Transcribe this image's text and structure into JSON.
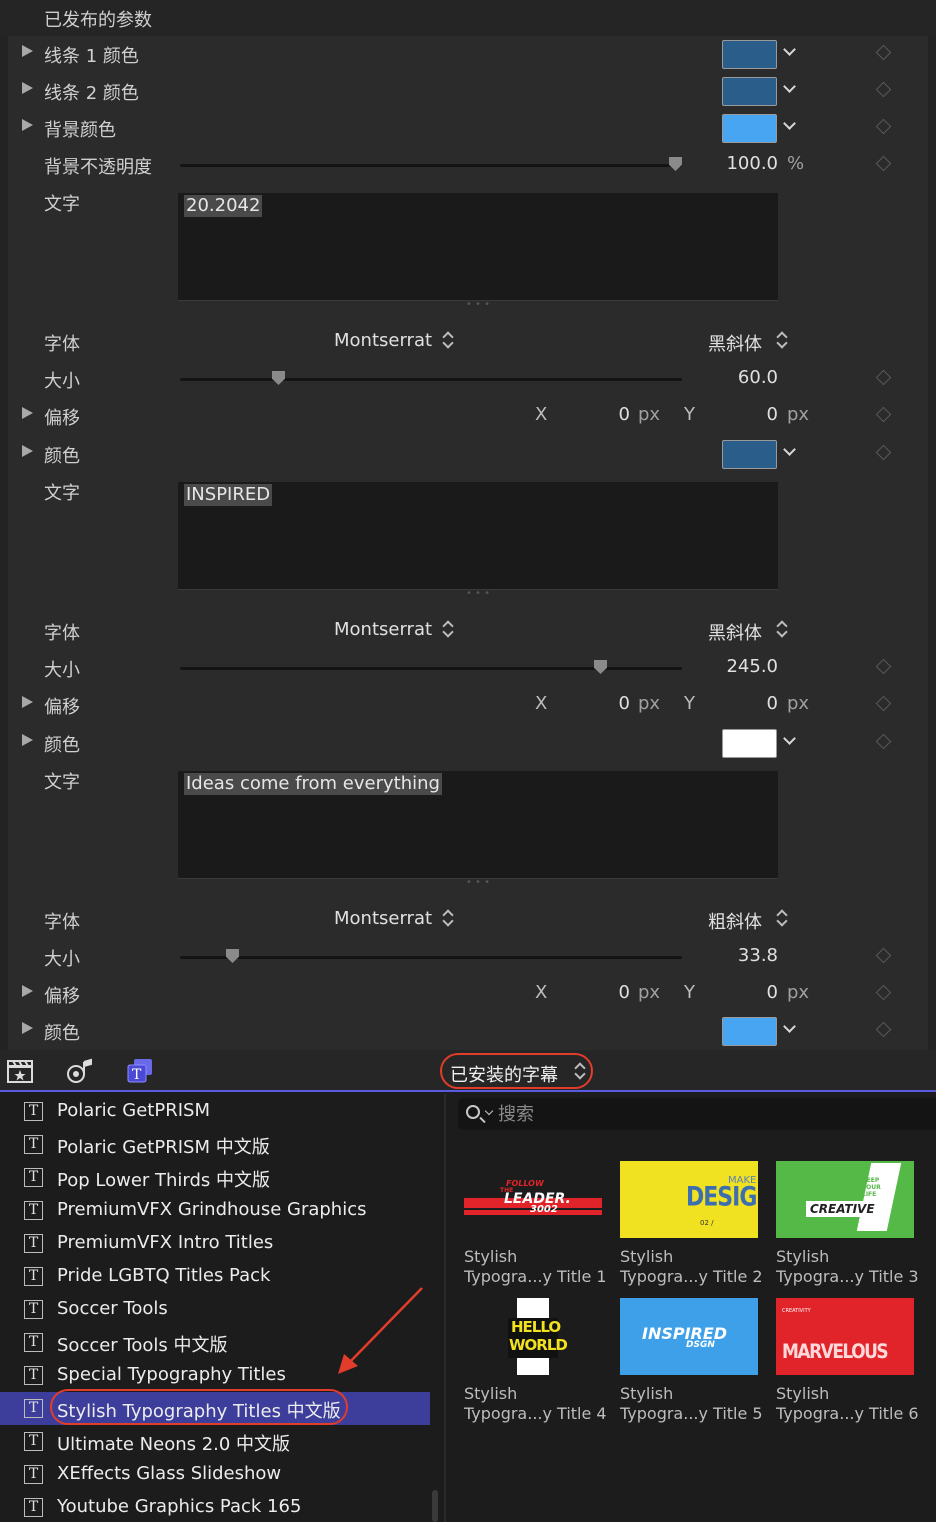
{
  "inspector": {
    "header": "已发布的参数",
    "line1_color_label": "线条 1 颜色",
    "line1_color": "#2b5d8a",
    "line2_color_label": "线条 2 颜色",
    "line2_color": "#2b5d8a",
    "bg_color_label": "背景颜色",
    "bg_color": "#47a5f2",
    "bg_opacity_label": "背景不透明度",
    "bg_opacity_value": "100.0",
    "bg_opacity_unit": "%",
    "groups": [
      {
        "text_label": "文字",
        "text_value": "20.2042",
        "font_label": "字体",
        "font_name": "Montserrat",
        "font_style": "黑斜体",
        "size_label": "大小",
        "size_value": "60.0",
        "offset_label": "偏移",
        "x_label": "X",
        "x_value": "0",
        "x_unit": "px",
        "y_label": "Y",
        "y_value": "0",
        "y_unit": "px",
        "color_label": "颜色",
        "color": "#2b5d8a"
      },
      {
        "text_label": "文字",
        "text_value": "INSPIRED",
        "font_label": "字体",
        "font_name": "Montserrat",
        "font_style": "黑斜体",
        "size_label": "大小",
        "size_value": "245.0",
        "offset_label": "偏移",
        "x_label": "X",
        "x_value": "0",
        "x_unit": "px",
        "y_label": "Y",
        "y_value": "0",
        "y_unit": "px",
        "color_label": "颜色",
        "color": "#ffffff"
      },
      {
        "text_label": "文字",
        "text_value": "Ideas come from everything",
        "font_label": "字体",
        "font_name": "Montserrat",
        "font_style": "粗斜体",
        "size_label": "大小",
        "size_value": "33.8",
        "offset_label": "偏移",
        "x_label": "X",
        "x_value": "0",
        "x_unit": "px",
        "y_label": "Y",
        "y_value": "0",
        "y_unit": "px",
        "color_label": "颜色",
        "color": "#47a5f2"
      }
    ]
  },
  "browser": {
    "toolbar": {
      "icons": [
        "clapper-icon",
        "music-icon",
        "titles-icon"
      ],
      "installed_label": "已安装的字幕"
    },
    "list": [
      {
        "name": "Polaric GetPRISM"
      },
      {
        "name": "Polaric GetPRISM 中文版"
      },
      {
        "name": "Pop Lower Thirds 中文版"
      },
      {
        "name": "PremiumVFX Grindhouse Graphics"
      },
      {
        "name": "PremiumVFX Intro Titles"
      },
      {
        "name": "Pride LGBTQ Titles Pack"
      },
      {
        "name": "Soccer Tools"
      },
      {
        "name": "Soccer Tools 中文版"
      },
      {
        "name": "Special Typography Titles"
      },
      {
        "name": "Stylish Typography Titles 中文版",
        "selected": true
      },
      {
        "name": "Ultimate Neons 2.0 中文版"
      },
      {
        "name": "XEffects Glass Slideshow"
      },
      {
        "name": "Youtube Graphics Pack 165"
      }
    ],
    "search_placeholder": "搜索",
    "tiles": [
      {
        "line1": "Stylish",
        "line2": "Typogra...y Title 1",
        "thumb_text": [
          "FOLLOW",
          "THE",
          "LEADER.",
          "3002"
        ]
      },
      {
        "line1": "Stylish",
        "line2": "Typogra...y Title 2",
        "thumb_text": [
          "MAKE",
          "DESIGN",
          "02 /"
        ]
      },
      {
        "line1": "Stylish",
        "line2": "Typogra...y Title 3",
        "thumb_text": [
          "CREATIVE",
          "KEEP YOUR LIFE"
        ]
      },
      {
        "line1": "Stylish",
        "line2": "Typogra...y Title 4",
        "thumb_text": [
          "HELLO",
          "WORLD"
        ]
      },
      {
        "line1": "Stylish",
        "line2": "Typogra...y Title 5",
        "thumb_text": [
          "INSPIRED",
          "DSGN"
        ]
      },
      {
        "line1": "Stylish",
        "line2": "Typogra...y Title 6",
        "thumb_text": [
          "MARVELOUS",
          "CREATIVITY"
        ]
      }
    ]
  }
}
